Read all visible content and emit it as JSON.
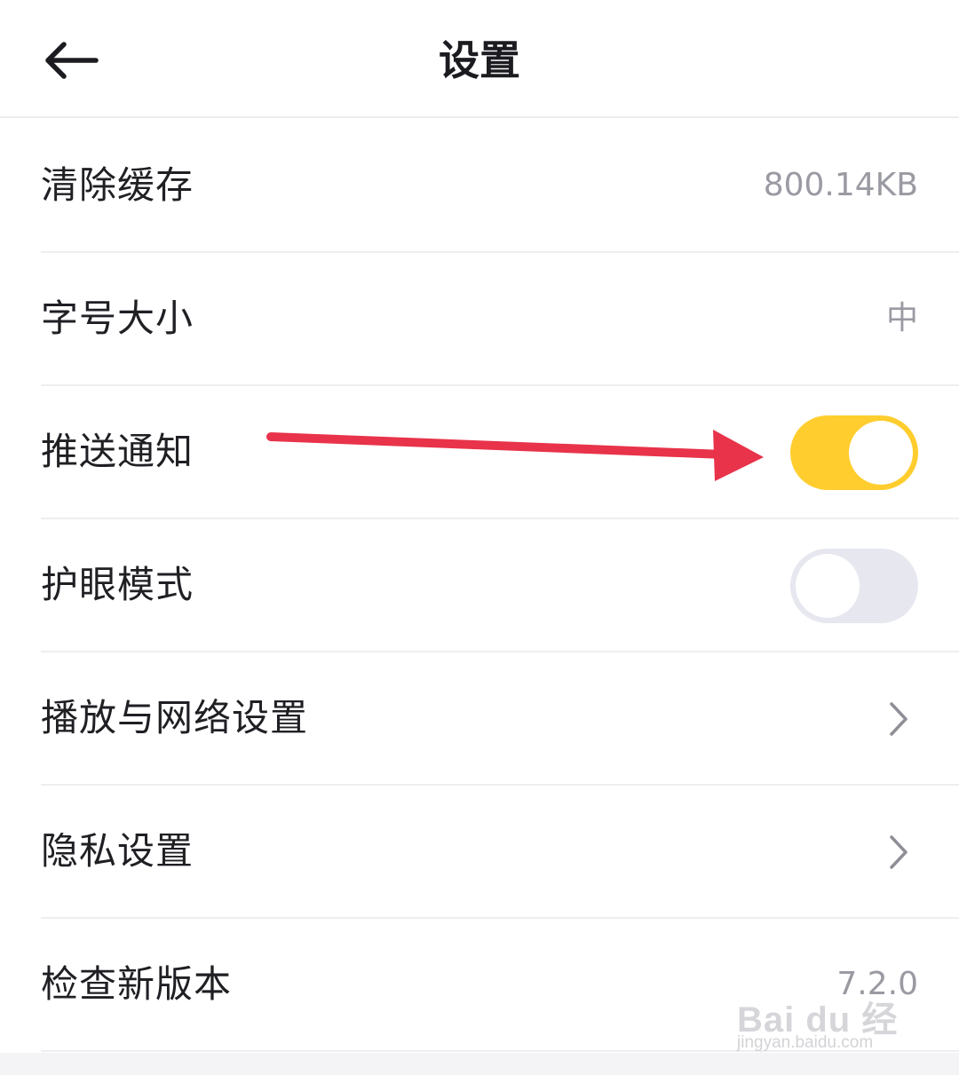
{
  "header": {
    "title": "设置",
    "back_icon": "arrow-left-icon"
  },
  "settings": [
    {
      "label": "清除缓存",
      "value": "800.14KB",
      "type": "value"
    },
    {
      "label": "字号大小",
      "value": "中",
      "type": "value"
    },
    {
      "label": "推送通知",
      "type": "toggle",
      "state": "on"
    },
    {
      "label": "护眼模式",
      "type": "toggle",
      "state": "off"
    },
    {
      "label": "播放与网络设置",
      "type": "chevron"
    },
    {
      "label": "隐私设置",
      "type": "chevron"
    },
    {
      "label": "检查新版本",
      "value": "7.2.0",
      "type": "value"
    }
  ],
  "annotation": {
    "type": "arrow",
    "color": "#e8334a",
    "points_to": "推送通知 toggle"
  },
  "watermark": {
    "logo": "Bai du 经验",
    "url": "jingyan.baidu.com"
  },
  "colors": {
    "toggle_on": "#ffcd2e",
    "toggle_off": "#e6e7ef",
    "secondary_text": "#9a9aa3",
    "divider": "#eeeef1"
  }
}
